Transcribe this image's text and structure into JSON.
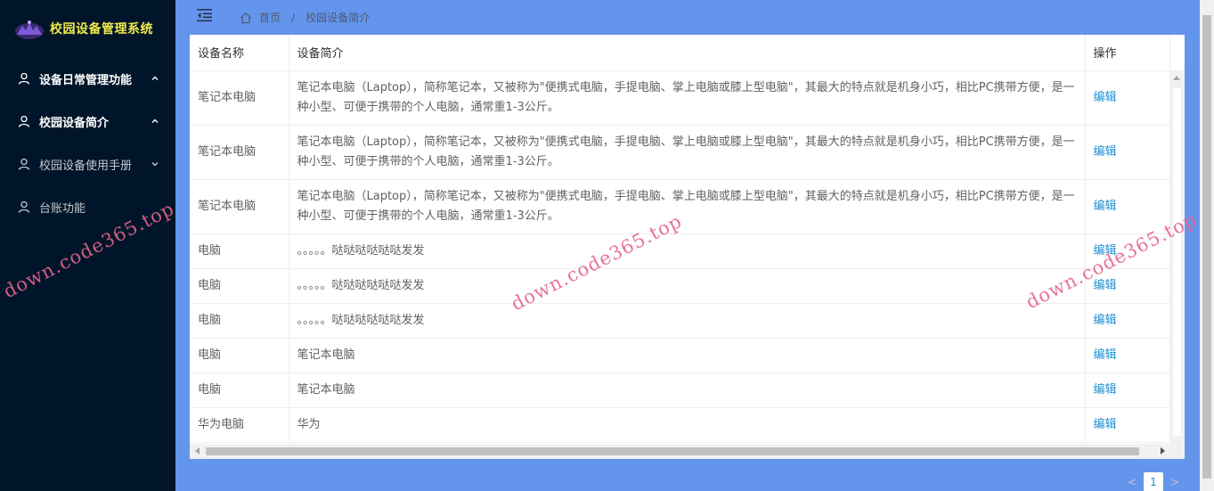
{
  "app": {
    "title": "校园设备管理系统"
  },
  "sidebar": {
    "items": [
      {
        "label": "设备日常管理功能",
        "arrow": "up"
      },
      {
        "label": "校园设备简介",
        "arrow": "up"
      },
      {
        "label": "校园设备使用手册",
        "arrow": "down"
      },
      {
        "label": "台账功能",
        "arrow": ""
      }
    ]
  },
  "breadcrumb": {
    "home": "首页",
    "separator": "/",
    "current": "校园设备简介"
  },
  "table": {
    "headers": {
      "name": "设备名称",
      "desc": "设备简介",
      "op": "操作"
    },
    "rows": [
      {
        "name": "笔记本电脑",
        "desc": "笔记本电脑（Laptop），简称笔记本，又被称为\"便携式电脑，手提电脑、掌上电脑或膝上型电脑\"，其最大的特点就是机身小巧，相比PC携带方便，是一种小型、可便于携带的个人电脑，通常重1-3公斤。",
        "op": "编辑"
      },
      {
        "name": "笔记本电脑",
        "desc": "笔记本电脑（Laptop），简称笔记本，又被称为\"便携式电脑，手提电脑、掌上电脑或膝上型电脑\"，其最大的特点就是机身小巧，相比PC携带方便，是一种小型、可便于携带的个人电脑，通常重1-3公斤。",
        "op": "编辑"
      },
      {
        "name": "笔记本电脑",
        "desc": "笔记本电脑（Laptop），简称笔记本，又被称为\"便携式电脑，手提电脑、掌上电脑或膝上型电脑\"，其最大的特点就是机身小巧，相比PC携带方便，是一种小型、可便于携带的个人电脑，通常重1-3公斤。",
        "op": "编辑"
      },
      {
        "name": "电脑",
        "desc": "。。。。。哒哒哒哒哒哒发发",
        "op": "编辑"
      },
      {
        "name": "电脑",
        "desc": "。。。。。哒哒哒哒哒哒发发",
        "op": "编辑"
      },
      {
        "name": "电脑",
        "desc": "。。。。。哒哒哒哒哒哒发发",
        "op": "编辑"
      },
      {
        "name": "电脑",
        "desc": "笔记本电脑",
        "op": "编辑"
      },
      {
        "name": "电脑",
        "desc": "笔记本电脑",
        "op": "编辑"
      },
      {
        "name": "华为电脑",
        "desc": "华为",
        "op": "编辑"
      }
    ]
  },
  "pagination": {
    "prev": "<",
    "current": "1",
    "next": ">"
  },
  "watermark": {
    "text": "down.code365.top"
  },
  "colors": {
    "sidebar_bg": "#001529",
    "page_bg": "#6495ed",
    "title": "#f0e94a",
    "link": "#1f8fd1",
    "watermark": "#e7648a"
  },
  "icons": {
    "user": "user-icon",
    "fold": "menu-fold-icon",
    "home": "home-icon"
  }
}
